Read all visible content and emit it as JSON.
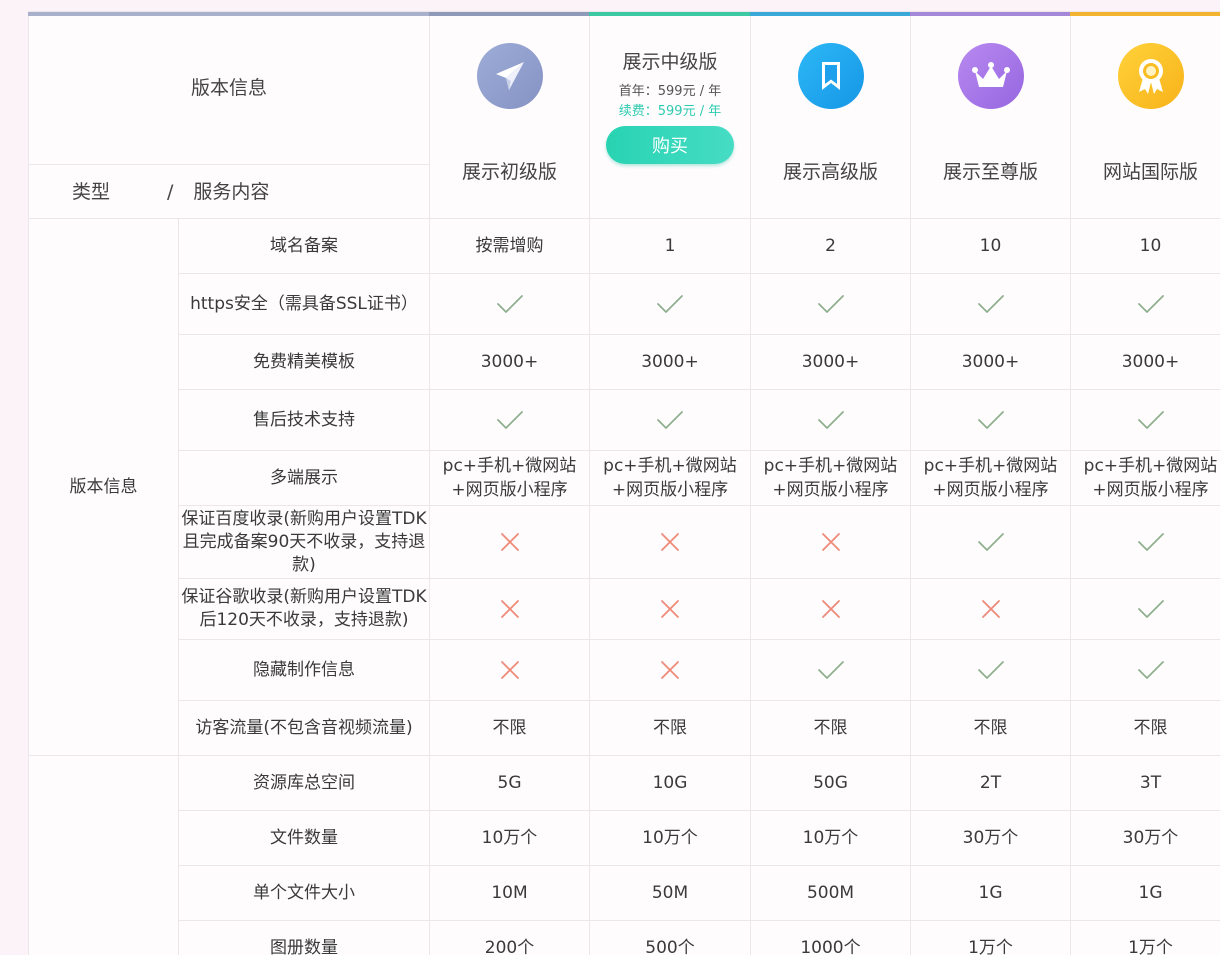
{
  "header": {
    "version_info": "版本信息",
    "type_label": "类型",
    "slash": "/",
    "service_label": "服务内容",
    "plans": [
      {
        "name": "展示初级版",
        "color": "#8fa0cc",
        "icon": "paper-plane-icon"
      },
      {
        "name": "展示中级版",
        "color": "#2fd1b4",
        "price_first": "首年：599元 / 年",
        "price_renew": "续费：599元 / 年",
        "buy_label": "购买"
      },
      {
        "name": "展示高级版",
        "color": "#1fa7ee",
        "icon": "bookmark-icon"
      },
      {
        "name": "展示至尊版",
        "color": "#a67ae6",
        "icon": "crown-icon"
      },
      {
        "name": "网站国际版",
        "color": "#f7b52a",
        "icon": "medal-icon"
      }
    ]
  },
  "categories": [
    {
      "name": "版本信息"
    },
    {
      "name": ""
    }
  ],
  "rows": [
    {
      "feature": "域名备案",
      "values": [
        "按需增购",
        "1",
        "2",
        "10",
        "10"
      ]
    },
    {
      "feature": "https安全（需具备SSL证书）",
      "values": [
        "check",
        "check",
        "check",
        "check",
        "check"
      ]
    },
    {
      "feature": "免费精美模板",
      "values": [
        "3000+",
        "3000+",
        "3000+",
        "3000+",
        "3000+"
      ]
    },
    {
      "feature": "售后技术支持",
      "values": [
        "check",
        "check",
        "check",
        "check",
        "check"
      ]
    },
    {
      "feature": "多端展示",
      "values": [
        "pc+手机+微网站+网页版小程序",
        "pc+手机+微网站+网页版小程序",
        "pc+手机+微网站+网页版小程序",
        "pc+手机+微网站+网页版小程序",
        "pc+手机+微网站+网页版小程序"
      ]
    },
    {
      "feature": "保证百度收录(新购用户设置TDK且完成备案90天不收录，支持退款)",
      "values": [
        "cross",
        "cross",
        "cross",
        "check",
        "check"
      ]
    },
    {
      "feature": "保证谷歌收录(新购用户设置TDK后120天不收录，支持退款)",
      "values": [
        "cross",
        "cross",
        "cross",
        "cross",
        "check"
      ]
    },
    {
      "feature": "隐藏制作信息",
      "values": [
        "cross",
        "cross",
        "check",
        "check",
        "check"
      ]
    },
    {
      "feature": "访客流量(不包含音视频流量)",
      "values": [
        "不限",
        "不限",
        "不限",
        "不限",
        "不限"
      ]
    },
    {
      "feature": "资源库总空间",
      "values": [
        "5G",
        "10G",
        "50G",
        "2T",
        "3T"
      ]
    },
    {
      "feature": "文件数量",
      "values": [
        "10万个",
        "10万个",
        "10万个",
        "30万个",
        "30万个"
      ]
    },
    {
      "feature": "单个文件大小",
      "values": [
        "10M",
        "50M",
        "500M",
        "1G",
        "1G"
      ]
    },
    {
      "feature": "图册数量",
      "values": [
        "200个",
        "500个",
        "1000个",
        "1万个",
        "1万个"
      ]
    }
  ],
  "colors": {
    "check": "#8fb08f",
    "cross": "#ee8a78"
  }
}
